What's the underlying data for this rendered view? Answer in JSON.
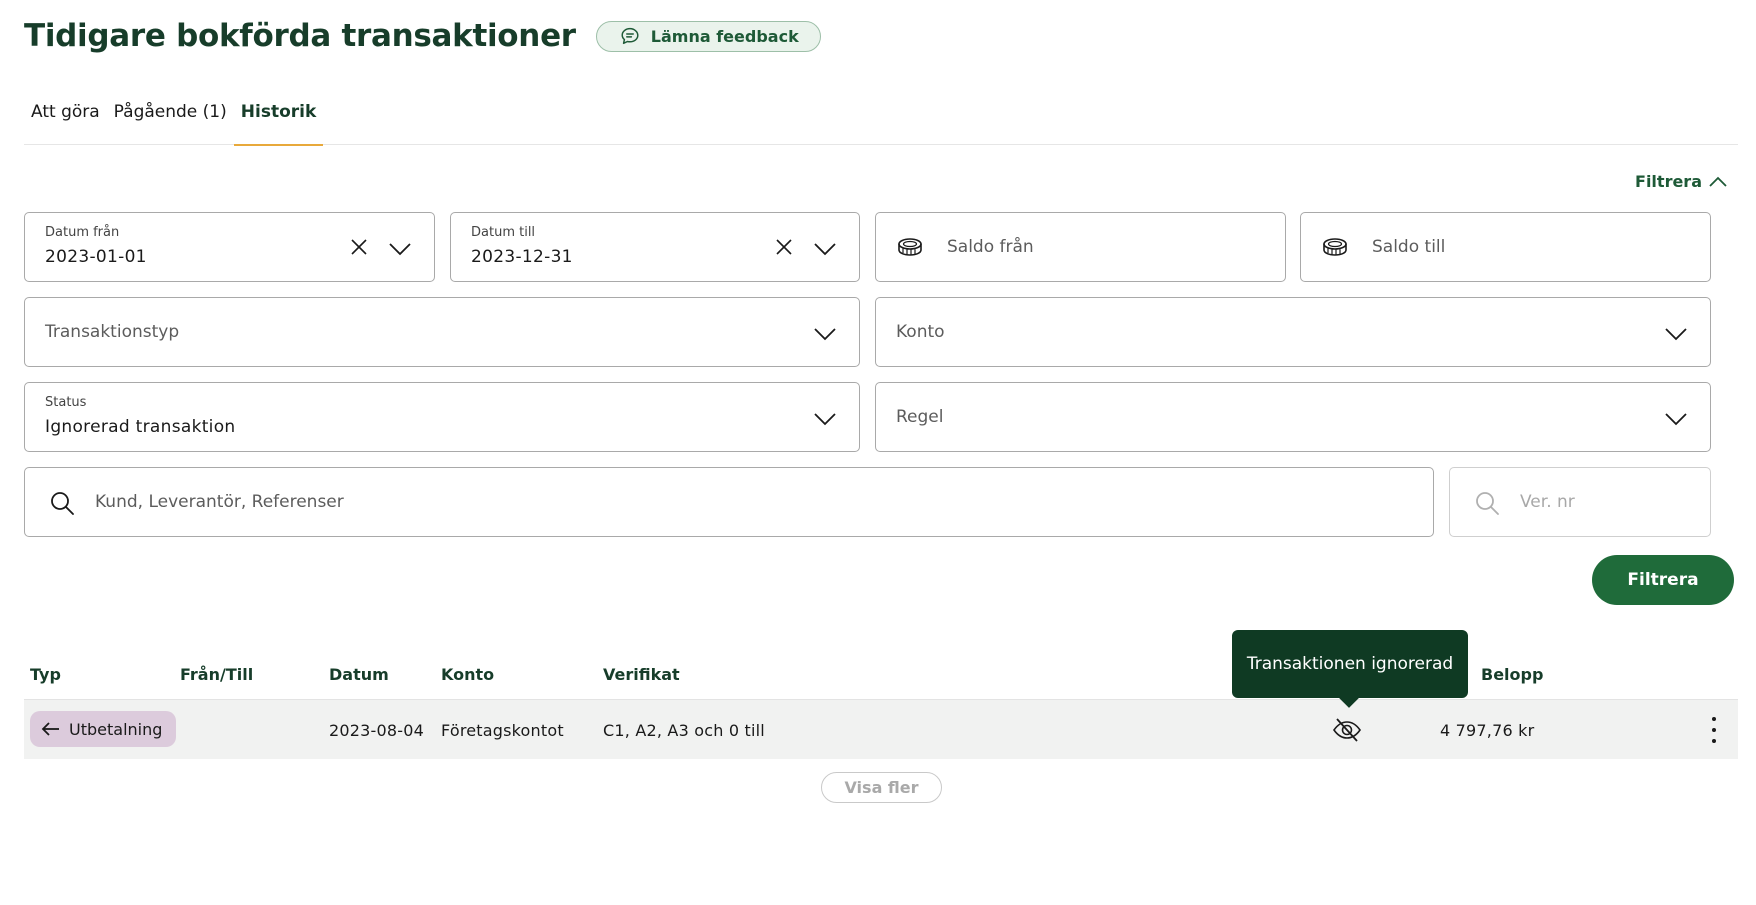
{
  "header": {
    "title": "Tidigare bokförda transaktioner",
    "feedback_label": "Lämna feedback"
  },
  "tabs": [
    {
      "label": "Att göra",
      "active": false
    },
    {
      "label": "Pågående (1)",
      "active": false
    },
    {
      "label": "Historik",
      "active": true
    }
  ],
  "filter": {
    "toggle_label": "Filtrera",
    "date_from": {
      "label": "Datum från",
      "value": "2023-01-01"
    },
    "date_to": {
      "label": "Datum till",
      "value": "2023-12-31"
    },
    "balance_from": {
      "placeholder": "Saldo från"
    },
    "balance_to": {
      "placeholder": "Saldo till"
    },
    "transaction_type": {
      "placeholder": "Transaktionstyp"
    },
    "account": {
      "placeholder": "Konto"
    },
    "status": {
      "label": "Status",
      "value": "Ignorerad transaktion"
    },
    "rule": {
      "placeholder": "Regel"
    },
    "search": {
      "placeholder": "Kund, Leverantör, Referenser"
    },
    "ver_nr": {
      "placeholder": "Ver. nr"
    },
    "apply_label": "Filtrera"
  },
  "table": {
    "columns": [
      "Typ",
      "Från/Till",
      "Datum",
      "Konto",
      "Verifikat",
      "Belopp"
    ],
    "rows": [
      {
        "type": "Utbetalning",
        "from_to": "",
        "date": "2023-08-04",
        "account": "Företagskontot",
        "verification": "C1, A2, A3 och 0 till",
        "status_icon": "eye-off-icon",
        "amount": "4 797,76 kr"
      }
    ],
    "tooltip": "Transaktionen ignorerad",
    "show_more_label": "Visa fler"
  },
  "colors": {
    "brand_dark": "#173d2a",
    "brand_green": "#1f6b3a",
    "tab_accent": "#e8a93b",
    "badge_bg": "#dccbdc",
    "tooltip_bg": "#0f3a23"
  }
}
